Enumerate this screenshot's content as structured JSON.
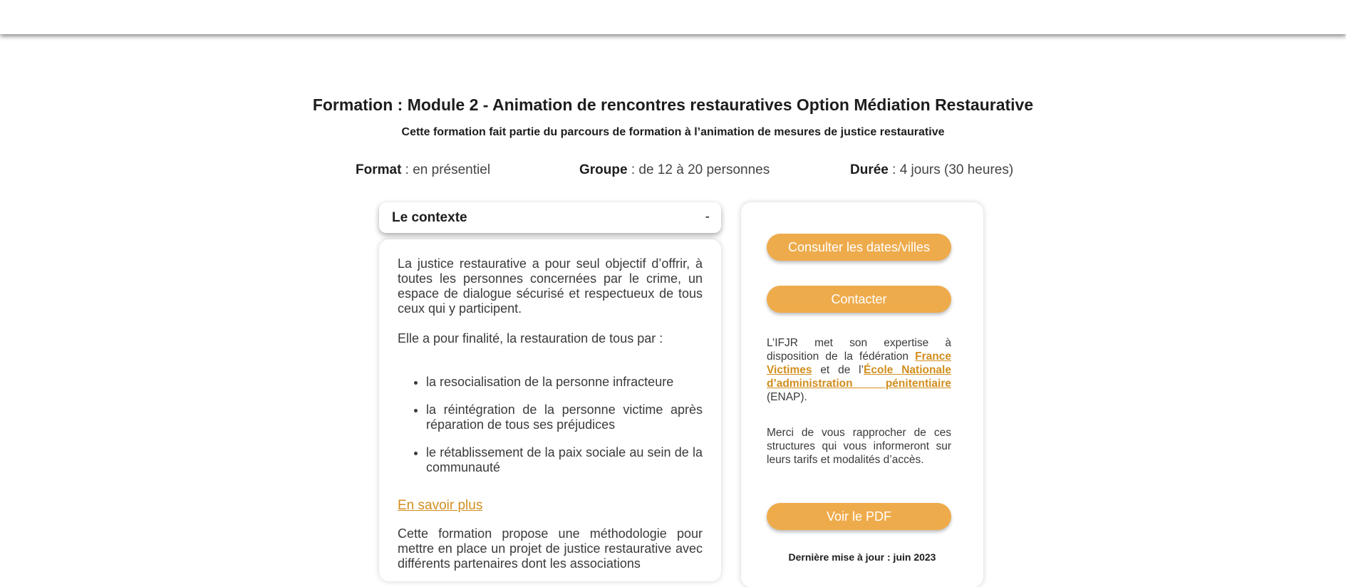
{
  "header": {
    "title": "Formation : Module 2 - Animation de rencontres restauratives Option Médiation Restaurative",
    "subtitle": "Cette formation fait partie du parcours de formation à l’animation de mesures de justice restaurative"
  },
  "info": {
    "format_label": "Format",
    "format_value": " : en présentiel",
    "groupe_label": "Groupe",
    "groupe_value": " : de 12 à 20 personnes",
    "duree_label": "Durée",
    "duree_value": " : 4 jours (30 heures)"
  },
  "accordion": {
    "title": "Le contexte",
    "toggle": "-",
    "paragraph_1": "La justice restaurative a pour seul objectif d’offrir, à toutes les personnes concernées par le crime, un espace de dialogue sécurisé et respectueux de tous ceux qui y participent.",
    "paragraph_2": "Elle a pour finalité, la restauration de tous par :",
    "bullets": [
      "la resocialisation de la personne infracteure",
      "la réintégration de la personne victime après réparation de tous ses préjudices",
      "le rétablissement de la paix sociale au sein de la communauté"
    ],
    "more_link": "En savoir plus",
    "paragraph_3": "Cette formation propose une méthodologie pour mettre en place un projet de justice restaurative avec différents partenaires dont les associations"
  },
  "sidebar": {
    "dates_button": "Consulter les dates/villes",
    "contact_button": "Contacter",
    "text_1_start": "L’IFJR met son expertise à disposition de la fédération ",
    "link_france_victimes": "France Victimes",
    "text_1_middle": " et de l’",
    "link_enap": "École Nationale d’administration pénitentiaire",
    "text_1_end": " (ENAP).",
    "text_2": "Merci de vous rapprocher de ces structures qui vous informeront sur leurs tarifs et modalités d’accès.",
    "pdf_button": "Voir le PDF",
    "last_update": "Dernière mise à jour : juin 2023"
  },
  "colors": {
    "accent": "#eeab4b",
    "link": "#d18e1e",
    "heading": "#1d1d1d",
    "text": "#3a3a3a"
  }
}
